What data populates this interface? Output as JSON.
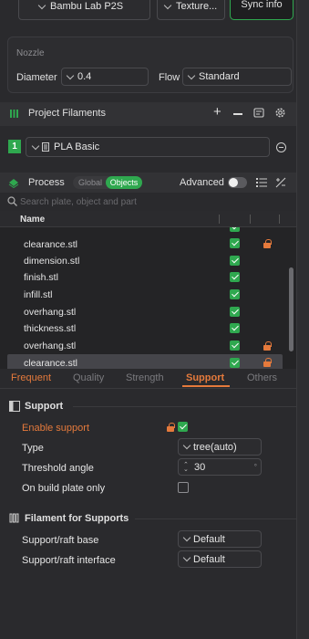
{
  "top_bar": {
    "printer": "Bambu Lab P2S",
    "plate_type": "Texture...",
    "sync_button": "Sync info"
  },
  "nozzle": {
    "section_title": "Nozzle",
    "diameter_label": "Diameter",
    "diameter_value": "0.4",
    "flow_label": "Flow",
    "flow_value": "Standard"
  },
  "filaments": {
    "title": "Project Filaments",
    "slot_number": "1",
    "slot_color": "#2fa84f",
    "filament_name": "PLA Basic"
  },
  "process": {
    "title": "Process",
    "mode_global": "Global",
    "mode_objects": "Objects",
    "advanced_label": "Advanced",
    "search_placeholder": "Search plate, object and part"
  },
  "object_list": {
    "header_name": "Name",
    "rows": [
      {
        "name": "clearance.stl",
        "locked": true
      },
      {
        "name": "dimension.stl",
        "locked": false
      },
      {
        "name": "finish.stl",
        "locked": false
      },
      {
        "name": "infill.stl",
        "locked": false
      },
      {
        "name": "overhang.stl",
        "locked": false
      },
      {
        "name": "thickness.stl",
        "locked": false
      },
      {
        "name": "overhang.stl",
        "locked": true
      },
      {
        "name": "clearance.stl",
        "locked": true
      }
    ]
  },
  "tabs": [
    "Frequent",
    "Quality",
    "Strength",
    "Support",
    "Others"
  ],
  "active_tab": "Support",
  "support": {
    "section_title": "Support",
    "enable_label": "Enable support",
    "type_label": "Type",
    "type_value": "tree(auto)",
    "threshold_label": "Threshold angle",
    "threshold_value": "30",
    "threshold_unit": "°",
    "build_plate_label": "On build plate only"
  },
  "filament_supports": {
    "section_title": "Filament for Supports",
    "base_label": "Support/raft base",
    "base_value": "Default",
    "interface_label": "Support/raft interface",
    "interface_value": "Default"
  },
  "colors": {
    "accent_orange": "#e57a3c",
    "accent_green": "#2fa84f",
    "panel_bg": "#2a2a2d"
  }
}
